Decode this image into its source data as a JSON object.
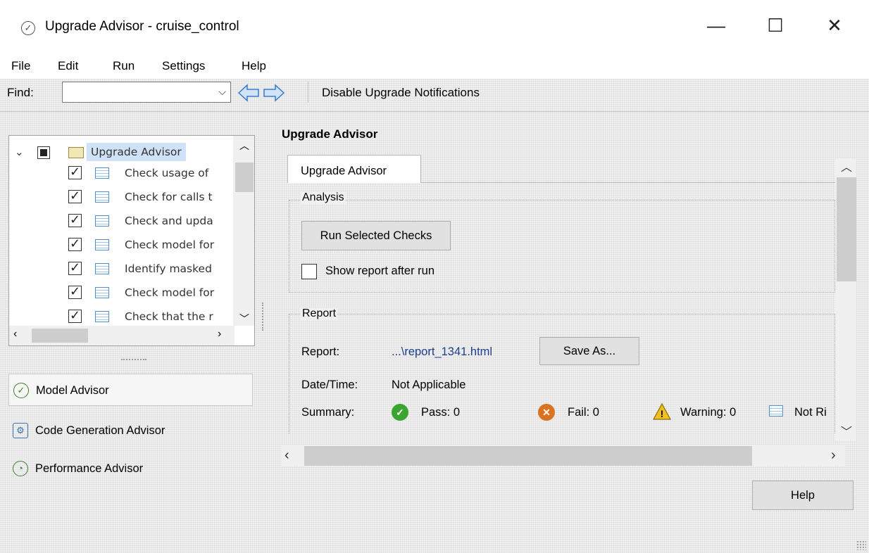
{
  "window": {
    "title": "Upgrade Advisor - cruise_control",
    "minimize": "—",
    "maximize": "☐",
    "close": "✕"
  },
  "menu": [
    "File",
    "Edit",
    "Run",
    "Settings",
    "Help"
  ],
  "toolbar": {
    "find_label": "Find:",
    "find_value": "",
    "disable_label": "Disable Upgrade Notifications"
  },
  "tree": {
    "root_label": "Upgrade Advisor",
    "items": [
      "Check usage of",
      "Check for calls t",
      "Check and upda",
      "Check model for",
      "Identify masked",
      "Check model for",
      "Check that the r"
    ]
  },
  "advisors": [
    "Model Advisor",
    "Code Generation Advisor",
    "Performance Advisor"
  ],
  "main": {
    "heading": "Upgrade Advisor",
    "tab_label": "Upgrade Advisor",
    "analysis": {
      "title": "Analysis",
      "run_button": "Run Selected Checks",
      "show_report_label": "Show report after run",
      "show_report_checked": false
    },
    "report": {
      "title": "Report",
      "report_label": "Report:",
      "report_link": "...\\report_1341.html",
      "save_as": "Save As...",
      "date_label": "Date/Time:",
      "date_value": "Not Applicable",
      "summary_label": "Summary:",
      "pass": "Pass: 0",
      "fail": "Fail: 0",
      "warning": "Warning: 0",
      "not_run": "Not Ri"
    }
  },
  "help_button": "Help",
  "colors": {
    "pass": "#3aa52f",
    "fail": "#d9731f",
    "warning": "#f2c01e",
    "link": "#1d3e8c"
  }
}
